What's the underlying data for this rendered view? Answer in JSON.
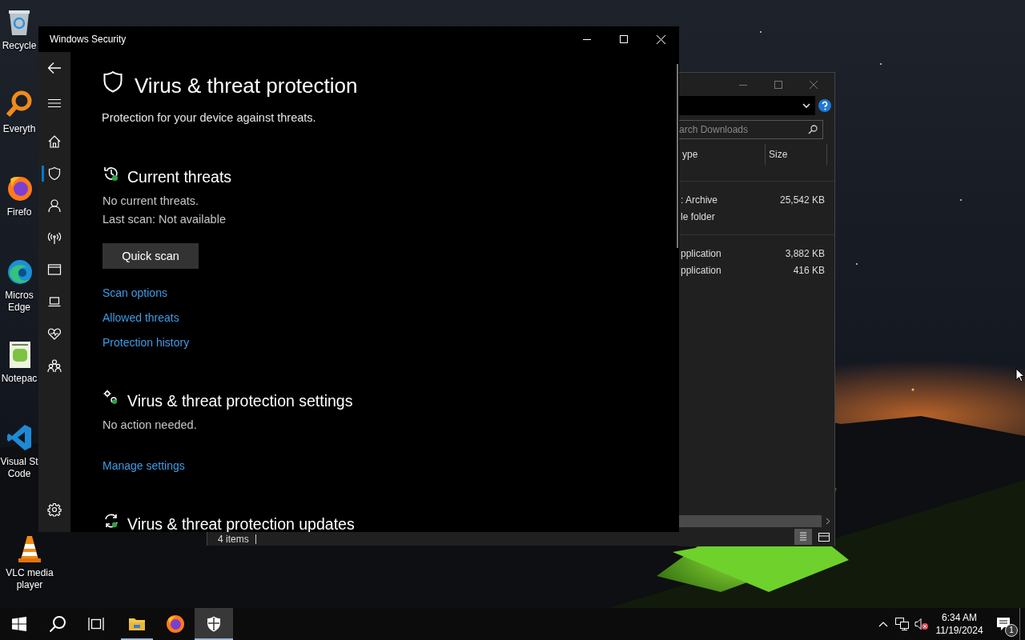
{
  "desktop": {
    "icons": [
      {
        "label": "Recycle"
      },
      {
        "label": "Everyth"
      },
      {
        "label": "Firefo"
      },
      {
        "label": "Micros Edge"
      },
      {
        "label": "Notepac"
      },
      {
        "label": "Visual St Code"
      },
      {
        "label": "VLC media player"
      }
    ]
  },
  "explorer_window": {
    "search": {
      "placeholder": "arch Downloads"
    },
    "columns": [
      "ype",
      "Size"
    ],
    "groups": [
      {
        "rows": [
          {
            "type": ": Archive",
            "size": "25,542 KB"
          },
          {
            "type": "le folder"
          }
        ]
      },
      {
        "rows": [
          {
            "type": "pplication",
            "size": "3,882 KB"
          },
          {
            "type": "pplication",
            "size": "416 KB"
          }
        ]
      }
    ],
    "status": "4 items"
  },
  "security_window": {
    "title": "Windows Security",
    "nav": [
      {
        "selected": false
      },
      {
        "selected": true
      },
      {
        "selected": false
      },
      {
        "selected": false
      },
      {
        "selected": false
      },
      {
        "selected": false
      },
      {
        "selected": false
      },
      {
        "selected": false
      },
      {
        "selected": false
      }
    ],
    "page": {
      "title": "Virus & threat protection",
      "subtitle": "Protection for your device against threats."
    },
    "sections": [
      {
        "title": "Current threats",
        "lines": [
          "No current threats.",
          "Last scan: Not available"
        ],
        "button": "Quick scan",
        "links": [
          "Scan options",
          "Allowed threats",
          "Protection history"
        ]
      },
      {
        "title": "Virus & threat protection settings",
        "lines": [
          "No action needed."
        ],
        "links": [
          "Manage settings"
        ]
      },
      {
        "title": "Virus & threat protection updates"
      }
    ]
  },
  "taskbar": {
    "apps": [
      {
        "running": true,
        "selected": false
      },
      {
        "running": false,
        "selected": false
      },
      {
        "running": true,
        "selected": true
      }
    ],
    "clock": {
      "time": "6:34 AM",
      "date": "11/19/2024"
    },
    "notifications": {
      "count": "1"
    }
  }
}
